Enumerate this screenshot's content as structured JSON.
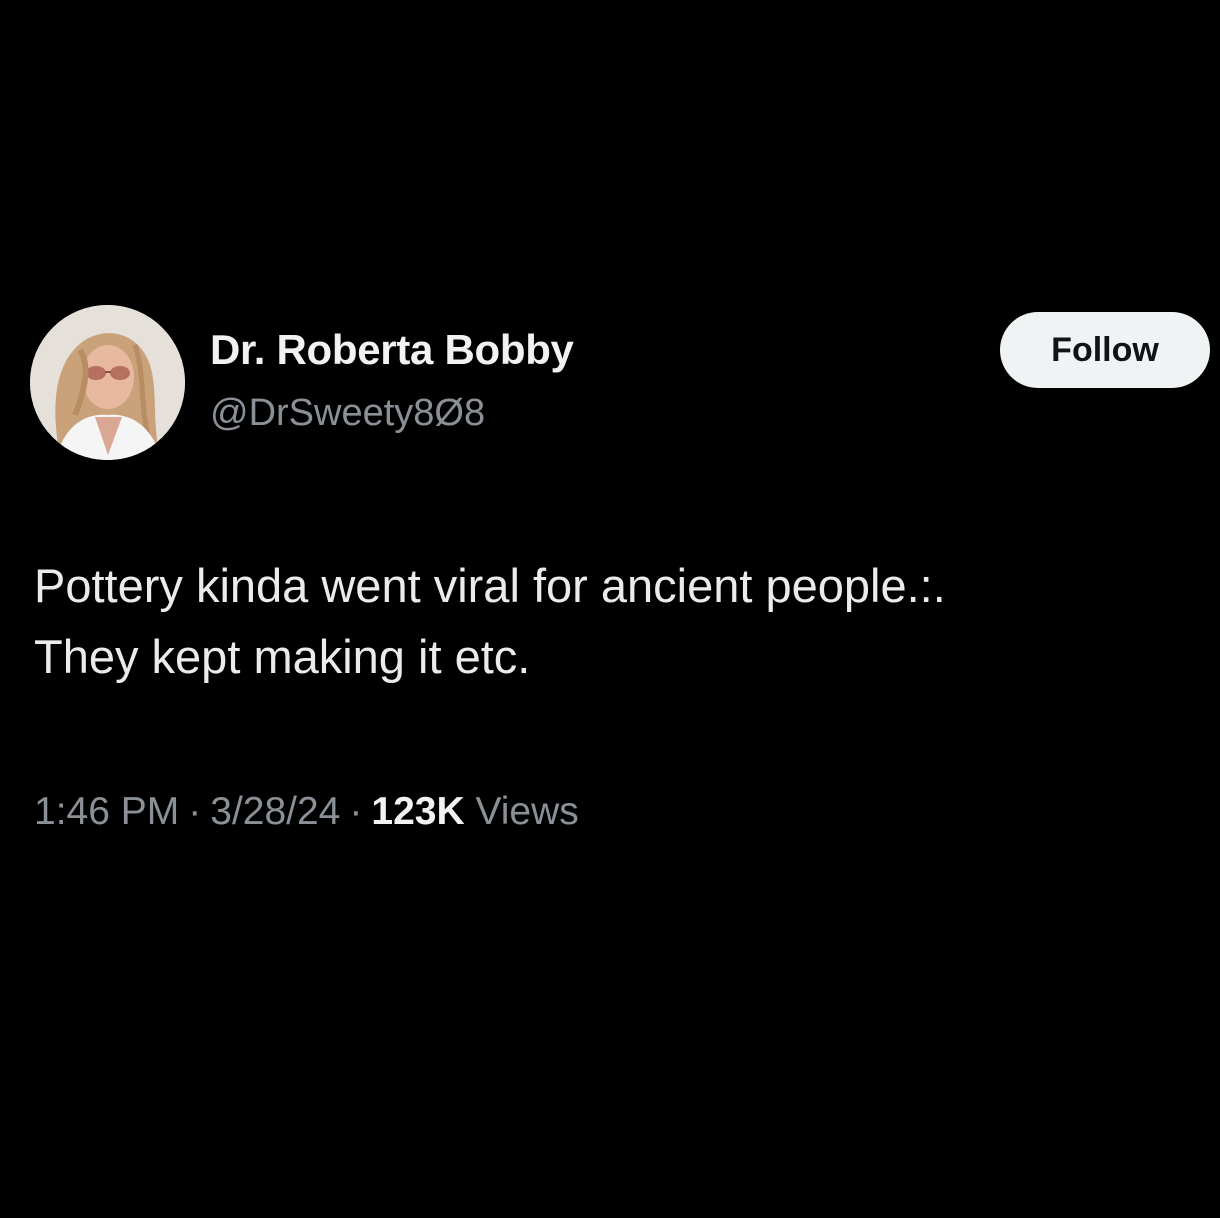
{
  "author": {
    "display_name": "Dr. Roberta Bobby",
    "handle": "@DrSweety8Ø8",
    "avatar_icon": "profile-photo-icon"
  },
  "follow_button": {
    "label": "Follow"
  },
  "tweet": {
    "lines": [
      "Pottery kinda went viral for ancient people.:.",
      "They kept making it etc."
    ]
  },
  "meta": {
    "time": "1:46 PM",
    "separator": "·",
    "date": "3/28/24",
    "views_count": "123K",
    "views_label": "Views"
  },
  "colors": {
    "background": "#000000",
    "primary_text": "#e7e9ea",
    "secondary_text": "#8b9096",
    "button_bg": "#eff3f4",
    "button_text": "#0f1419"
  }
}
